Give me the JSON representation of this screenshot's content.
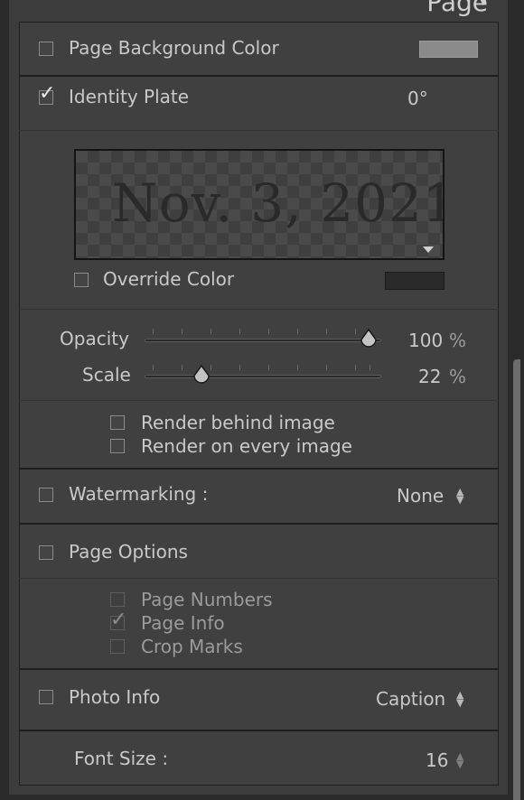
{
  "panel": {
    "title": "Page"
  },
  "page_background": {
    "label": "Page Background Color",
    "checked": false,
    "swatch_color": "#8b8b8b"
  },
  "identity_plate": {
    "label": "Identity Plate",
    "checked": true,
    "rotation": "0°",
    "plate_text": "Nov. 3, 2021",
    "override_color": {
      "label": "Override Color",
      "checked": false,
      "swatch_color": "#2a2a2a"
    },
    "opacity": {
      "label": "Opacity",
      "value": "100",
      "unit": "%",
      "level": 1.0
    },
    "scale": {
      "label": "Scale",
      "value": "22",
      "unit": "%",
      "level": 0.22
    },
    "render_behind": {
      "label": "Render behind image",
      "checked": false
    },
    "render_every": {
      "label": "Render on every image",
      "checked": false
    }
  },
  "watermarking": {
    "label": "Watermarking :",
    "checked": false,
    "value": "None"
  },
  "page_options": {
    "label": "Page Options",
    "checked": false,
    "items": [
      {
        "label": "Page Numbers",
        "checked": false
      },
      {
        "label": "Page Info",
        "checked": true
      },
      {
        "label": "Crop Marks",
        "checked": false
      }
    ]
  },
  "photo_info": {
    "label": "Photo Info",
    "checked": false,
    "value": "Caption"
  },
  "font_size": {
    "label": "Font Size :",
    "value": "16"
  }
}
